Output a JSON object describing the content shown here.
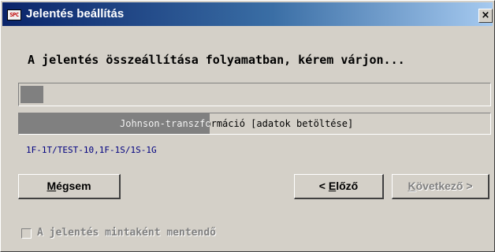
{
  "window": {
    "title": "Jelentés beállítás",
    "app_icon_text": "SPC",
    "close_label": "×"
  },
  "message": "A jelentés összeállítása folyamatban, kérem várjon...",
  "progress": {
    "overall_fraction": 0.048,
    "status_fraction": 0.405,
    "status_text": "Johnson-transzformáció [adatok betöltése]"
  },
  "path_text": "1F-1T/TEST-10,1F-1S/1S-1G",
  "buttons": {
    "cancel": {
      "before": "",
      "hotkey": "M",
      "after": "égsem"
    },
    "previous": {
      "before": "< ",
      "hotkey": "E",
      "after": "lőző"
    },
    "next": {
      "before": "",
      "hotkey": "K",
      "after": "övetkező >"
    }
  },
  "checkbox": {
    "label": "A jelentés mintaként mentendő",
    "checked": false
  },
  "colors": {
    "titlebar_start": "#0a246a",
    "titlebar_end": "#a6caf0",
    "dialog_bg": "#d4d0c8",
    "progress_fill": "#808080",
    "path_text": "#000080"
  }
}
